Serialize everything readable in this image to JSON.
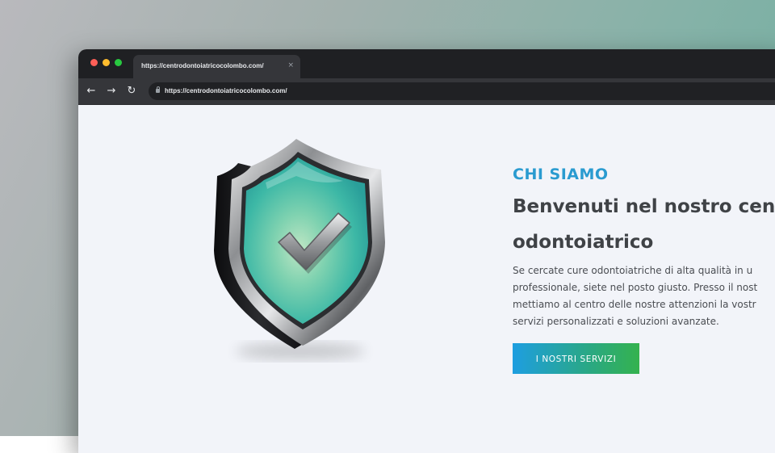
{
  "browser": {
    "tab_title": "https://centrodontoiatricocolombo.com/",
    "tab_close_icon": "×",
    "address_bar_url": "https://centrodontoiatricocolombo.com/",
    "back_icon": "←",
    "forward_icon": "→",
    "reload_icon": "↻"
  },
  "hero": {
    "illustration": "shield-check-icon",
    "eyebrow": "CHI SIAMO",
    "heading_lines": [
      "Benvenuti nel nostro cen",
      "odontoiatrico"
    ],
    "body_lines": [
      "Se cercate cure odontoiatriche di alta qualità in u",
      "professionale, siete nel posto giusto. Presso il nost",
      "mettiamo al centro delle nostre attenzioni la vostr",
      "servizi personalizzati e soluzioni avanzate."
    ],
    "cta_label": "I NOSTRI SERVIZI"
  },
  "colors": {
    "eyebrow": "#2a9bd0",
    "heading": "#3f4246",
    "cta_gradient_start": "#1e9ee0",
    "cta_gradient_end": "#34b24e",
    "page_background": "#f2f4f9"
  }
}
